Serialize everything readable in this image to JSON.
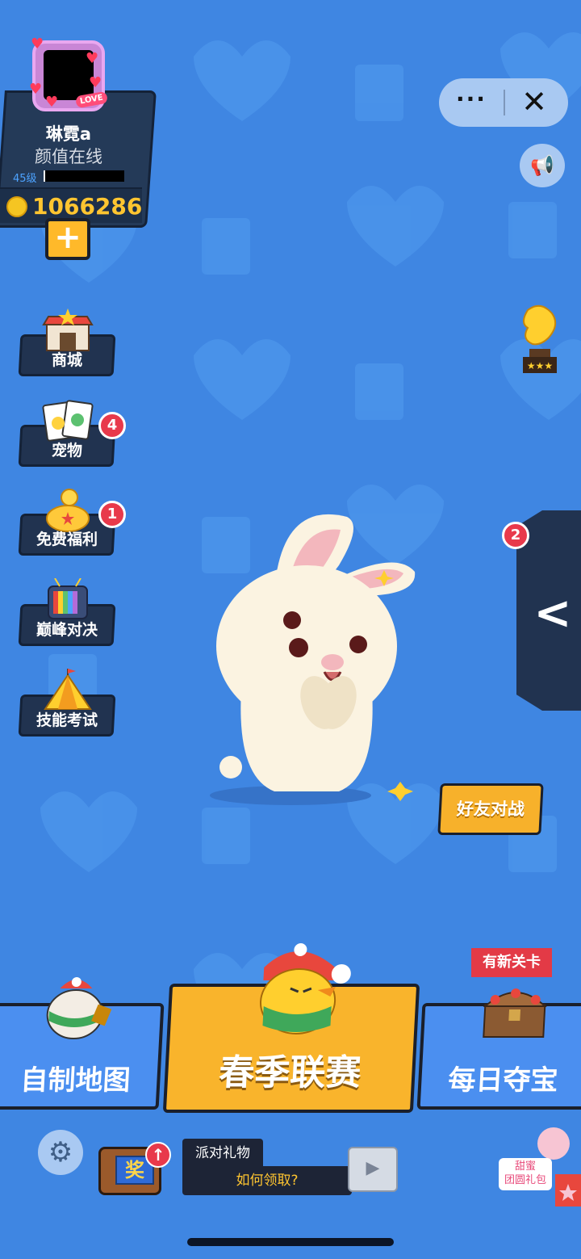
{
  "profile": {
    "name": "琳霓a",
    "title": "颜值在线",
    "level": "45级",
    "coins": "1066286",
    "avatar_tag": "LOVE"
  },
  "top_bar": {
    "more_icon": "···",
    "close_icon": "✕"
  },
  "left_menu": [
    {
      "label": "商城",
      "icon": "shop-icon",
      "badge": ""
    },
    {
      "label": "宠物",
      "icon": "pet-cards-icon",
      "badge": "4"
    },
    {
      "label": "免费福利",
      "icon": "piggy-bank-icon",
      "badge": "1"
    },
    {
      "label": "巅峰对决",
      "icon": "tv-icon",
      "badge": ""
    },
    {
      "label": "技能考试",
      "icon": "tent-icon",
      "badge": ""
    }
  ],
  "right_panel": {
    "badge": "2",
    "arrow": "<"
  },
  "friend_battle": "好友对战",
  "bottom_buttons": {
    "map": "自制地图",
    "league": "春季联赛",
    "treasure": "每日夺宝",
    "new_tag": "有新关卡"
  },
  "bottom_strip": {
    "prize_char": "奖",
    "party_title": "派对礼物",
    "party_sub": "如何领取?",
    "gift_label_line1": "甜蜜",
    "gift_label_line2": "团圆礼包"
  },
  "colors": {
    "background": "#3f86e2",
    "panel": "#213350",
    "accent_yellow": "#f9b42c",
    "badge_red": "#e8394b"
  }
}
